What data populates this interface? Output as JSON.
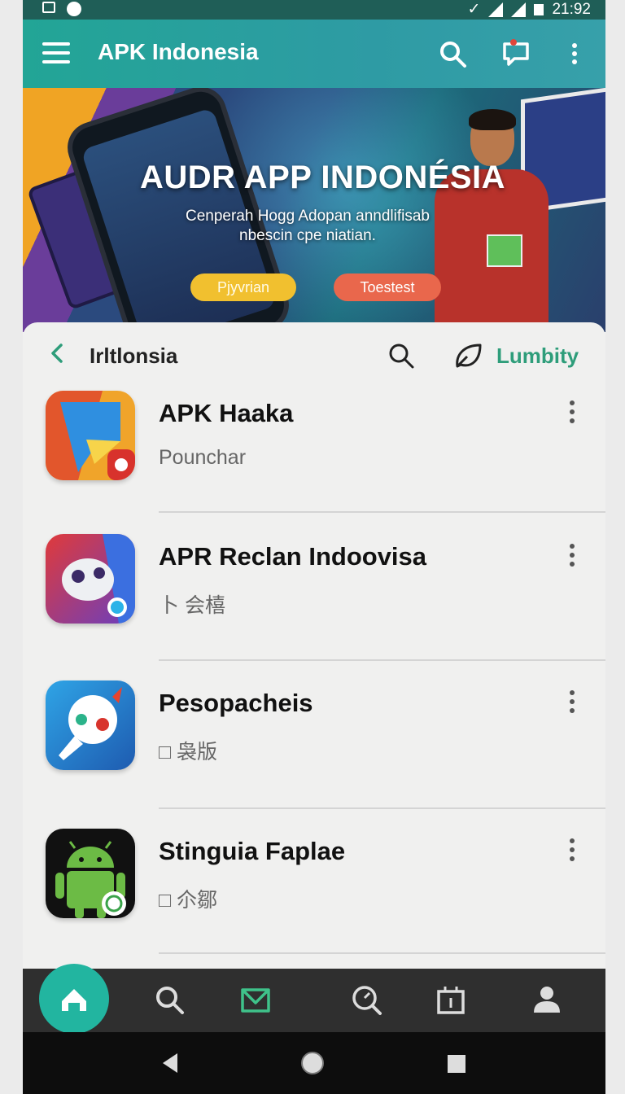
{
  "status_bar": {
    "time": "21:92"
  },
  "app_bar": {
    "title": "APK Indonesia"
  },
  "banner": {
    "title": "AUDR APP INDONÉSIA",
    "subtitle": "Cenperah Hogg Adopan anndlifisab nbescin cpe niatian.",
    "button_primary": "Pjyvrian",
    "button_secondary": "Toestest"
  },
  "sub_header": {
    "title": "Irltlonsia",
    "action_label": "Lumbity"
  },
  "apps": [
    {
      "name": "APK Haaka",
      "subtitle": "Pounchar"
    },
    {
      "name": "APR Reclan Indoovisa",
      "subtitle": "卜 会橲"
    },
    {
      "name": "Pesopacheis",
      "subtitle": "□ 袅版"
    },
    {
      "name": "Stinguia Faplae",
      "subtitle": "□ 尒鄒"
    }
  ],
  "colors": {
    "accent": "#22a596",
    "status_bar": "#1f5e57",
    "nav_bar": "#2f2f2f",
    "highlight": "#2e9d7a"
  },
  "bottom_nav": {
    "icons": [
      "home-icon",
      "search-icon",
      "inbox-icon",
      "discover-icon",
      "library-icon",
      "profile-icon"
    ]
  }
}
